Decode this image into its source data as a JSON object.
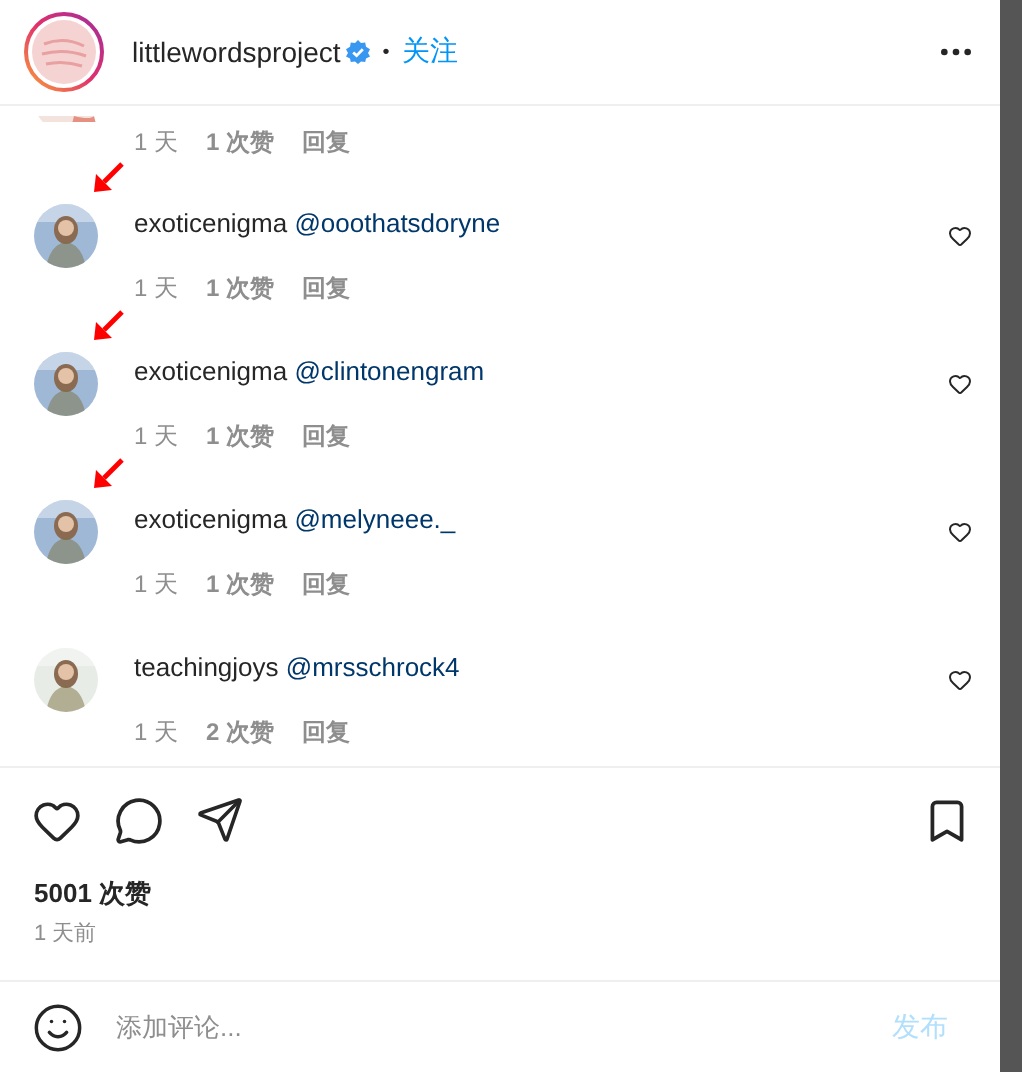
{
  "header": {
    "username": "littlewordsproject",
    "verified": true,
    "separator": "•",
    "follow": "关注"
  },
  "partial_comment": {
    "time": "1 天",
    "likes": "1 次赞",
    "reply": "回复"
  },
  "comments": [
    {
      "user": "exoticenigma",
      "mention": "@ooothatsdoryne",
      "time": "1 天",
      "likes": "1 次赞",
      "reply": "回复",
      "marked": true,
      "color": "#9fb8d6"
    },
    {
      "user": "exoticenigma",
      "mention": "@clintonengram",
      "time": "1 天",
      "likes": "1 次赞",
      "reply": "回复",
      "marked": true,
      "color": "#9fb8d6"
    },
    {
      "user": "exoticenigma",
      "mention": "@melyneee._",
      "time": "1 天",
      "likes": "1 次赞",
      "reply": "回复",
      "marked": true,
      "color": "#9fb8d6"
    },
    {
      "user": "teachingjoys",
      "mention": "@mrsschrock4",
      "time": "1 天",
      "likes": "2 次赞",
      "reply": "回复",
      "marked": false,
      "color": "#e8ece6"
    }
  ],
  "likes": "5001 次赞",
  "posted": "1 天前",
  "composer": {
    "placeholder": "添加评论...",
    "submit": "发布"
  }
}
